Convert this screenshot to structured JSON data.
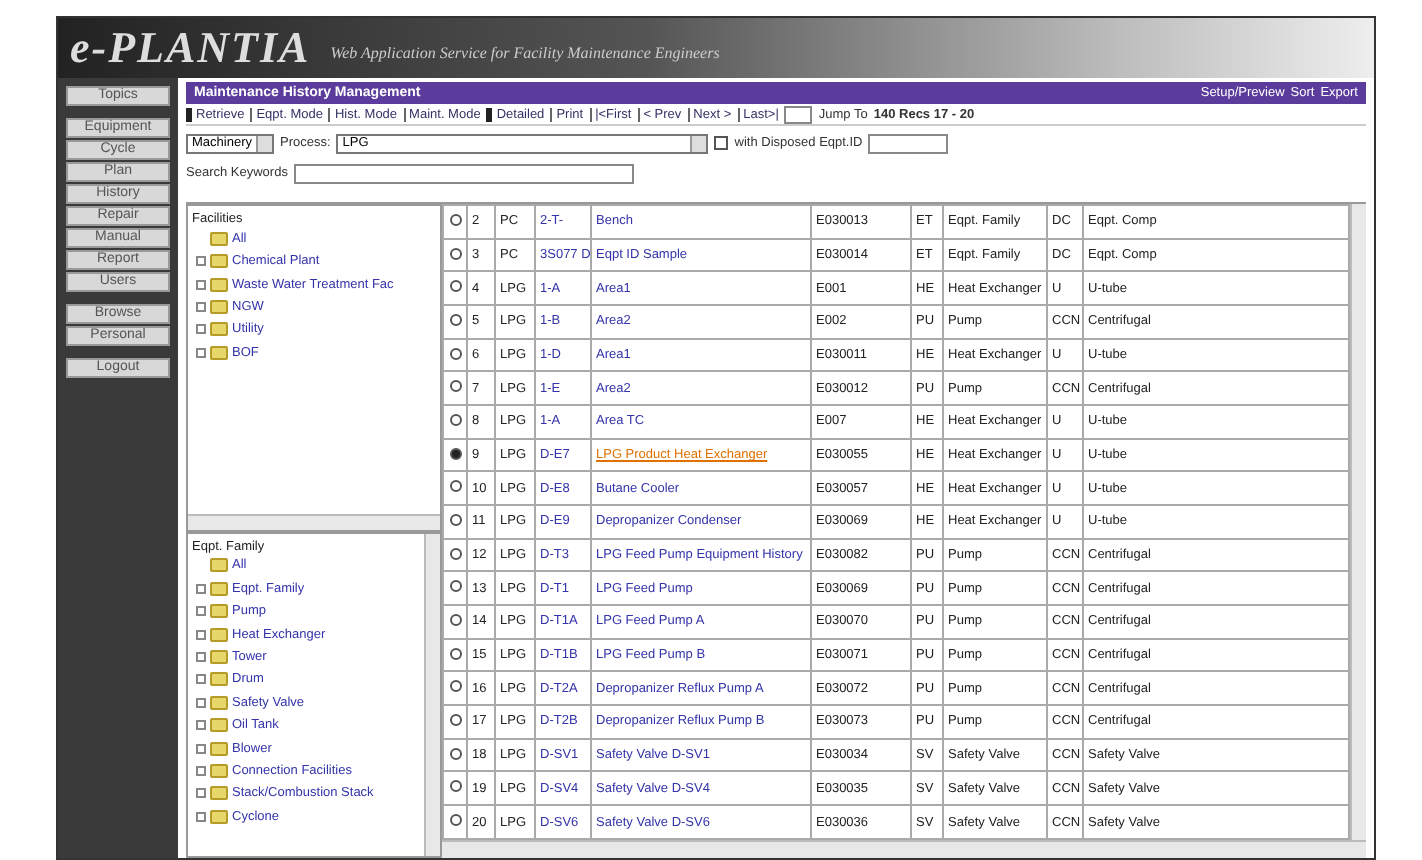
{
  "header": {
    "logo": "e-PLANTIA",
    "subtitle": "Web Application Service for Facility Maintenance Engineers"
  },
  "sidebar": {
    "groups": [
      [
        "Topics"
      ],
      [
        "Equipment",
        "Cycle",
        "Plan",
        "History",
        "Repair",
        "Manual",
        "Report",
        "Users"
      ],
      [
        "Browse",
        "Personal"
      ],
      [
        "Logout"
      ]
    ]
  },
  "title_bar": {
    "title": "Maintenance History Management",
    "links": [
      "Setup/Preview",
      "Sort",
      "Export"
    ]
  },
  "nav": {
    "items": [
      {
        "label": "Retrieve",
        "kind": "button"
      },
      {
        "label": "Eqpt. Mode",
        "kind": "link"
      },
      {
        "label": "Hist. Mode",
        "kind": "link"
      },
      {
        "label": "Maint. Mode",
        "kind": "link"
      },
      {
        "label": "Detailed",
        "kind": "button"
      },
      {
        "label": "Print",
        "kind": "link"
      },
      {
        "label": "|<First",
        "kind": "link"
      },
      {
        "label": "< Prev",
        "kind": "link"
      },
      {
        "label": "Next >",
        "kind": "link"
      },
      {
        "label": "Last>|",
        "kind": "link"
      }
    ],
    "jump_label": "Jump To",
    "records": "140 Recs 17 - 20"
  },
  "filters": {
    "category": "Machinery",
    "process_label": "Process:",
    "process": "LPG",
    "disposed_label": "with Disposed Eqpt.ID",
    "disposed_checked": false,
    "search_label": "Search Keywords"
  },
  "facilities_tree": {
    "title": "Facilities",
    "items": [
      {
        "label": "All",
        "has_children": false
      },
      {
        "label": "Chemical Plant",
        "has_children": true
      },
      {
        "label": "Waste Water Treatment Fac",
        "has_children": true
      },
      {
        "label": "NGW",
        "has_children": true
      },
      {
        "label": "Utility",
        "has_children": true
      },
      {
        "label": "BOF",
        "has_children": true
      }
    ]
  },
  "family_tree": {
    "title": "Eqpt. Family",
    "items": [
      {
        "label": "All",
        "has_children": false
      },
      {
        "label": "Eqpt. Family",
        "has_children": true
      },
      {
        "label": "Pump",
        "has_children": true
      },
      {
        "label": "Heat Exchanger",
        "has_children": true
      },
      {
        "label": "Tower",
        "has_children": true
      },
      {
        "label": "Drum",
        "has_children": true
      },
      {
        "label": "Safety Valve",
        "has_children": true
      },
      {
        "label": "Oil Tank",
        "has_children": true
      },
      {
        "label": "Blower",
        "has_children": true
      },
      {
        "label": "Connection Facilities",
        "has_children": true
      },
      {
        "label": "Stack/Combustion Stack",
        "has_children": true
      },
      {
        "label": "Cyclone",
        "has_children": true
      }
    ]
  },
  "table": {
    "rows": [
      {
        "selected": false,
        "cells": [
          "2",
          "PC",
          "2-T-",
          "Bench",
          "E030013",
          "ET",
          "Eqpt. Family",
          "DC",
          "Eqpt. Comp"
        ]
      },
      {
        "selected": false,
        "cells": [
          "3",
          "PC",
          "3S077 D",
          "Eqpt ID Sample",
          "E030014",
          "ET",
          "Eqpt. Family",
          "DC",
          "Eqpt. Comp"
        ]
      },
      {
        "selected": false,
        "cells": [
          "4",
          "LPG",
          "1-A",
          "Area1",
          "E001",
          "HE",
          "Heat Exchanger",
          "U",
          "U-tube"
        ]
      },
      {
        "selected": false,
        "cells": [
          "5",
          "LPG",
          "1-B",
          "Area2",
          "E002",
          "PU",
          "Pump",
          "CCN",
          "Centrifugal"
        ]
      },
      {
        "selected": false,
        "cells": [
          "6",
          "LPG",
          "1-D",
          "Area1",
          "E030011",
          "HE",
          "Heat Exchanger",
          "U",
          "U-tube"
        ]
      },
      {
        "selected": false,
        "cells": [
          "7",
          "LPG",
          "1-E",
          "Area2",
          "E030012",
          "PU",
          "Pump",
          "CCN",
          "Centrifugal"
        ]
      },
      {
        "selected": false,
        "cells": [
          "8",
          "LPG",
          "1-A",
          "Area TC",
          "E007",
          "HE",
          "Heat Exchanger",
          "U",
          "U-tube"
        ]
      },
      {
        "selected": true,
        "cells": [
          "9",
          "LPG",
          "D-E7",
          "LPG Product Heat Exchanger",
          "E030055",
          "HE",
          "Heat Exchanger",
          "U",
          "U-tube"
        ]
      },
      {
        "selected": false,
        "cells": [
          "10",
          "LPG",
          "D-E8",
          "Butane Cooler",
          "E030057",
          "HE",
          "Heat Exchanger",
          "U",
          "U-tube"
        ]
      },
      {
        "selected": false,
        "cells": [
          "11",
          "LPG",
          "D-E9",
          "Depropanizer Condenser",
          "E030069",
          "HE",
          "Heat Exchanger",
          "U",
          "U-tube"
        ]
      },
      {
        "selected": false,
        "cells": [
          "12",
          "LPG",
          "D-T3",
          "LPG Feed Pump Equipment History",
          "E030082",
          "PU",
          "Pump",
          "CCN",
          "Centrifugal"
        ]
      },
      {
        "selected": false,
        "cells": [
          "13",
          "LPG",
          "D-T1",
          "LPG Feed Pump",
          "E030069",
          "PU",
          "Pump",
          "CCN",
          "Centrifugal"
        ]
      },
      {
        "selected": false,
        "cells": [
          "14",
          "LPG",
          "D-T1A",
          "LPG Feed Pump A",
          "E030070",
          "PU",
          "Pump",
          "CCN",
          "Centrifugal"
        ]
      },
      {
        "selected": false,
        "cells": [
          "15",
          "LPG",
          "D-T1B",
          "LPG Feed Pump B",
          "E030071",
          "PU",
          "Pump",
          "CCN",
          "Centrifugal"
        ]
      },
      {
        "selected": false,
        "cells": [
          "16",
          "LPG",
          "D-T2A",
          "Depropanizer Reflux Pump A",
          "E030072",
          "PU",
          "Pump",
          "CCN",
          "Centrifugal"
        ]
      },
      {
        "selected": false,
        "cells": [
          "17",
          "LPG",
          "D-T2B",
          "Depropanizer Reflux Pump B",
          "E030073",
          "PU",
          "Pump",
          "CCN",
          "Centrifugal"
        ]
      },
      {
        "selected": false,
        "cells": [
          "18",
          "LPG",
          "D-SV1",
          "Safety Valve D-SV1",
          "E030034",
          "SV",
          "Safety Valve",
          "CCN",
          "Safety Valve"
        ]
      },
      {
        "selected": false,
        "cells": [
          "19",
          "LPG",
          "D-SV4",
          "Safety Valve D-SV4",
          "E030035",
          "SV",
          "Safety Valve",
          "CCN",
          "Safety Valve"
        ]
      },
      {
        "selected": false,
        "cells": [
          "20",
          "LPG",
          "D-SV6",
          "Safety Valve D-SV6",
          "E030036",
          "SV",
          "Safety Valve",
          "CCN",
          "Safety Valve"
        ]
      }
    ]
  }
}
